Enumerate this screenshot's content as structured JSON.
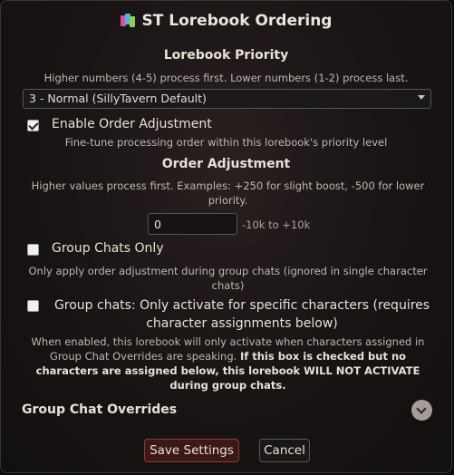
{
  "title": "ST Lorebook Ordering",
  "priority": {
    "heading": "Lorebook Priority",
    "hint": "Higher numbers (4-5) process first. Lower numbers (1-2) process last.",
    "selected": "3 - Normal (SillyTavern Default)"
  },
  "order_adjust_toggle": {
    "label": "Enable Order Adjustment",
    "checked": true,
    "hint": "Fine-tune processing order within this lorebook's priority level"
  },
  "order_adjustment": {
    "heading": "Order Adjustment",
    "hint": "Higher values process first. Examples: +250 for slight boost, -500 for lower priority.",
    "value": "0",
    "range": "-10k to +10k"
  },
  "group_chats_only": {
    "label": "Group Chats Only",
    "checked": false,
    "hint": "Only apply order adjustment during group chats (ignored in single character chats)"
  },
  "group_specific": {
    "label": "Group chats: Only activate for specific characters (requires character assignments below)",
    "checked": false,
    "hint": "When enabled, this lorebook will only activate when characters assigned in Group Chat Overrides are speaking.",
    "warning": "If this box is checked but no characters are assigned below, this lorebook WILL NOT ACTIVATE during group chats."
  },
  "overrides": {
    "heading": "Group Chat Overrides"
  },
  "buttons": {
    "save": "Save Settings",
    "cancel": "Cancel"
  },
  "icons": {
    "title": "books-icon",
    "expand": "chevron-down-icon"
  }
}
